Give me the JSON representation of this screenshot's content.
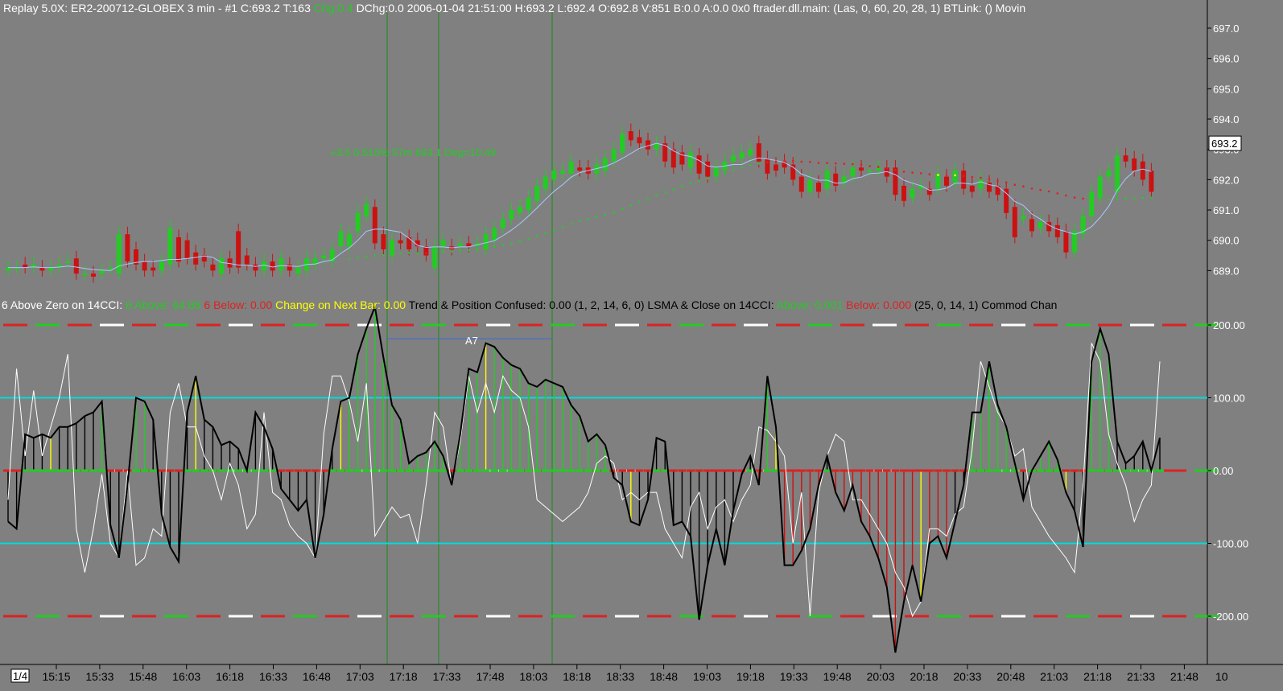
{
  "header": {
    "segments": [
      {
        "text": "Replay 5.0X: ER2-200712-GLOBEX  3 min  - #1   C:693.2  T:163  ",
        "color": "#ffffff"
      },
      {
        "text": "Chg:0.4",
        "color": "#22cc22"
      },
      {
        "text": "  DChg:0.0  2006-01-04  21:51:00  H:693.2  L:692.4  O:692.8  V:851  B:0.0  A:0.0  0x0  ftrader.dll.main:   (Las, 0, 60, 20, 28, 1)  BTLink:  ()  Movin",
        "color": "#ffffff"
      }
    ]
  },
  "subheader": {
    "segments": [
      {
        "text": "6 Above Zero on 14CCI: ",
        "color": "#ffffff"
      },
      {
        "text": "6 Above: 64.88 ",
        "color": "#22cc22"
      },
      {
        "text": "6 Below: 0.00 ",
        "color": "#dd2222"
      },
      {
        "text": "Change on Next Bar: 0.00 ",
        "color": "#ffff00"
      },
      {
        "text": "  Trend & Position Confused: 0.00   (1, 2, 14, 6, 0)   LSMA & Close on 14CCI: ",
        "color": "#000000"
      },
      {
        "text": "Above: 0.001 ",
        "color": "#22cc22"
      },
      {
        "text": "Below: 0.000 ",
        "color": "#dd2222"
      },
      {
        "text": "  (25, 0, 14, 1)   Commod Chan",
        "color": "#000000"
      }
    ]
  },
  "annotation_text": "+3.5  0.510%  57m  693.1  Deg=10.49",
  "marker_label": "A7",
  "x_axis": {
    "page_indicator": "1/4",
    "labels": [
      "15:15",
      "15:33",
      "15:48",
      "16:03",
      "16:18",
      "16:33",
      "16:48",
      "17:03",
      "17:18",
      "17:33",
      "17:48",
      "18:03",
      "18:18",
      "18:33",
      "18:48",
      "19:03",
      "19:18",
      "19:33",
      "19:48",
      "20:03",
      "20:18",
      "20:33",
      "20:48",
      "21:03",
      "21:18",
      "21:33",
      "21:48"
    ],
    "right_label": "10"
  },
  "colors": {
    "background": "#808080",
    "up_candle": "#22cc22",
    "down_candle": "#cc1111",
    "cci_line": "#000000",
    "fast_cci_line": "#ffffff",
    "level_100_line": "#00dddd",
    "vertical_marker": "#1a8a1a",
    "lsma_line": "#a8c8ff"
  },
  "chart_data": [
    {
      "type": "candlestick",
      "title": "ER2-200712-GLOBEX 3 min",
      "y_ticks": [
        "689.0",
        "690.0",
        "691.0",
        "692.0",
        "693.0",
        "694.0",
        "695.0",
        "696.0",
        "697.0"
      ],
      "ylim": [
        688.3,
        698.0
      ],
      "last_price": "693.2",
      "candles": [
        {
          "t": "15:09",
          "o": 689.0,
          "c": 689.1
        },
        {
          "t": "15:12",
          "o": 689.1,
          "c": 689.1
        },
        {
          "t": "15:15",
          "o": 689.2,
          "c": 689.1
        },
        {
          "t": "15:18",
          "o": 689.1,
          "c": 689.2
        },
        {
          "t": "15:21",
          "o": 689.1,
          "c": 689.0
        },
        {
          "t": "15:24",
          "o": 689.0,
          "c": 689.1
        },
        {
          "t": "15:27",
          "o": 689.1,
          "c": 689.2
        },
        {
          "t": "15:30",
          "o": 689.3,
          "c": 689.3
        },
        {
          "t": "15:33",
          "o": 689.4,
          "c": 688.9
        },
        {
          "t": "15:36",
          "o": 688.9,
          "c": 688.9
        },
        {
          "t": "15:39",
          "o": 688.9,
          "c": 688.8
        },
        {
          "t": "15:42",
          "o": 688.9,
          "c": 689.0
        },
        {
          "t": "15:45",
          "o": 689.1,
          "c": 689.1
        },
        {
          "t": "15:48",
          "o": 688.9,
          "c": 690.2
        },
        {
          "t": "15:51",
          "o": 690.2,
          "c": 689.3
        },
        {
          "t": "15:54",
          "o": 689.7,
          "c": 689.2
        },
        {
          "t": "15:57",
          "o": 689.3,
          "c": 689.0
        },
        {
          "t": "16:00",
          "o": 689.1,
          "c": 689.0
        },
        {
          "t": "16:03",
          "o": 689.0,
          "c": 689.3
        },
        {
          "t": "16:06",
          "o": 689.2,
          "c": 690.4
        },
        {
          "t": "16:09",
          "o": 690.1,
          "c": 689.3
        },
        {
          "t": "16:12",
          "o": 690.0,
          "c": 689.4
        },
        {
          "t": "16:15",
          "o": 689.6,
          "c": 689.2
        },
        {
          "t": "16:18",
          "o": 689.5,
          "c": 689.3
        },
        {
          "t": "16:21",
          "o": 689.2,
          "c": 689.0
        },
        {
          "t": "16:24",
          "o": 688.9,
          "c": 689.4
        },
        {
          "t": "16:27",
          "o": 689.4,
          "c": 689.1
        },
        {
          "t": "16:30",
          "o": 690.3,
          "c": 689.1
        },
        {
          "t": "16:33",
          "o": 689.5,
          "c": 689.2
        },
        {
          "t": "16:36",
          "o": 689.2,
          "c": 689.0
        },
        {
          "t": "16:39",
          "o": 689.0,
          "c": 689.3
        },
        {
          "t": "16:42",
          "o": 689.3,
          "c": 689.0
        },
        {
          "t": "16:45",
          "o": 689.0,
          "c": 689.4
        },
        {
          "t": "16:48",
          "o": 689.2,
          "c": 689.0
        },
        {
          "t": "16:51",
          "o": 688.9,
          "c": 689.1
        },
        {
          "t": "16:54",
          "o": 689.0,
          "c": 689.4
        },
        {
          "t": "16:57",
          "o": 689.2,
          "c": 689.4
        },
        {
          "t": "17:00",
          "o": 689.4,
          "c": 689.5
        },
        {
          "t": "17:03",
          "o": 689.3,
          "c": 689.7
        },
        {
          "t": "17:06",
          "o": 689.8,
          "c": 690.3
        },
        {
          "t": "17:09",
          "o": 689.8,
          "c": 690.2
        },
        {
          "t": "17:12",
          "o": 690.3,
          "c": 690.9
        },
        {
          "t": "17:15",
          "o": 690.8,
          "c": 691.2
        },
        {
          "t": "17:18",
          "o": 691.1,
          "c": 689.9
        },
        {
          "t": "17:21",
          "o": 690.2,
          "c": 689.7
        },
        {
          "t": "17:24",
          "o": 689.5,
          "c": 690.0
        },
        {
          "t": "17:27",
          "o": 690.0,
          "c": 689.9
        },
        {
          "t": "17:30",
          "o": 690.1,
          "c": 689.7
        },
        {
          "t": "17:33",
          "o": 690.0,
          "c": 689.8
        },
        {
          "t": "17:36",
          "o": 689.8,
          "c": 689.5
        },
        {
          "t": "17:39",
          "o": 689.1,
          "c": 689.8
        },
        {
          "t": "17:42",
          "o": 689.8,
          "c": 690.0
        },
        {
          "t": "17:45",
          "o": 689.8,
          "c": 689.7
        },
        {
          "t": "17:48",
          "o": 689.8,
          "c": 689.9
        },
        {
          "t": "17:51",
          "o": 689.9,
          "c": 689.8
        },
        {
          "t": "17:54",
          "o": 689.8,
          "c": 689.9
        },
        {
          "t": "17:57",
          "o": 689.7,
          "c": 690.2
        },
        {
          "t": "18:00",
          "o": 690.0,
          "c": 690.4
        },
        {
          "t": "18:03",
          "o": 690.4,
          "c": 690.7
        },
        {
          "t": "18:06",
          "o": 690.7,
          "c": 691.0
        },
        {
          "t": "18:09",
          "o": 690.9,
          "c": 691.1
        },
        {
          "t": "18:12",
          "o": 691.0,
          "c": 691.4
        },
        {
          "t": "18:15",
          "o": 691.3,
          "c": 691.8
        },
        {
          "t": "18:18",
          "o": 691.7,
          "c": 692.1
        },
        {
          "t": "18:21",
          "o": 692.0,
          "c": 692.3
        },
        {
          "t": "18:24",
          "o": 692.2,
          "c": 692.3
        },
        {
          "t": "18:27",
          "o": 692.2,
          "c": 692.6
        },
        {
          "t": "18:30",
          "o": 692.4,
          "c": 692.3
        },
        {
          "t": "18:33",
          "o": 692.4,
          "c": 692.2
        },
        {
          "t": "18:36",
          "o": 692.2,
          "c": 692.5
        },
        {
          "t": "18:39",
          "o": 692.3,
          "c": 692.7
        },
        {
          "t": "18:42",
          "o": 692.6,
          "c": 693.0
        },
        {
          "t": "18:45",
          "o": 692.9,
          "c": 693.5
        },
        {
          "t": "18:48",
          "o": 693.6,
          "c": 693.3
        },
        {
          "t": "18:51",
          "o": 693.4,
          "c": 693.2
        },
        {
          "t": "18:54",
          "o": 693.3,
          "c": 693.0
        },
        {
          "t": "18:57",
          "o": 693.0,
          "c": 693.2
        },
        {
          "t": "19:00",
          "o": 693.2,
          "c": 692.6
        },
        {
          "t": "19:03",
          "o": 693.0,
          "c": 692.4
        },
        {
          "t": "19:06",
          "o": 692.9,
          "c": 692.5
        },
        {
          "t": "19:09",
          "o": 692.4,
          "c": 692.9
        },
        {
          "t": "19:12",
          "o": 692.8,
          "c": 692.2
        },
        {
          "t": "19:15",
          "o": 692.6,
          "c": 692.1
        },
        {
          "t": "19:18",
          "o": 692.1,
          "c": 692.4
        },
        {
          "t": "19:21",
          "o": 692.3,
          "c": 692.6
        },
        {
          "t": "19:24",
          "o": 692.6,
          "c": 692.8
        },
        {
          "t": "19:27",
          "o": 692.7,
          "c": 692.9
        },
        {
          "t": "19:30",
          "o": 692.8,
          "c": 693.0
        },
        {
          "t": "19:33",
          "o": 693.2,
          "c": 692.6
        },
        {
          "t": "19:36",
          "o": 692.7,
          "c": 692.2
        },
        {
          "t": "19:39",
          "o": 692.5,
          "c": 692.3
        },
        {
          "t": "19:42",
          "o": 692.6,
          "c": 692.4
        },
        {
          "t": "19:45",
          "o": 692.5,
          "c": 692.0
        },
        {
          "t": "19:48",
          "o": 692.1,
          "c": 691.6
        },
        {
          "t": "19:51",
          "o": 691.6,
          "c": 692.0
        },
        {
          "t": "19:54",
          "o": 691.9,
          "c": 691.6
        },
        {
          "t": "19:57",
          "o": 691.7,
          "c": 692.3
        },
        {
          "t": "20:00",
          "o": 692.2,
          "c": 691.8
        },
        {
          "t": "20:03",
          "o": 691.9,
          "c": 692.1
        },
        {
          "t": "20:06",
          "o": 692.1,
          "c": 692.4
        },
        {
          "t": "20:09",
          "o": 692.4,
          "c": 692.3
        },
        {
          "t": "20:12",
          "o": 692.3,
          "c": 692.3
        },
        {
          "t": "20:15",
          "o": 692.3,
          "c": 692.4
        },
        {
          "t": "20:18",
          "o": 692.4,
          "c": 692.1
        },
        {
          "t": "20:21",
          "o": 692.4,
          "c": 691.5
        },
        {
          "t": "20:24",
          "o": 691.8,
          "c": 691.3
        },
        {
          "t": "20:27",
          "o": 691.4,
          "c": 691.7
        },
        {
          "t": "20:30",
          "o": 691.7,
          "c": 691.8
        },
        {
          "t": "20:33",
          "o": 691.7,
          "c": 691.5
        },
        {
          "t": "20:36",
          "o": 691.7,
          "c": 692.2
        },
        {
          "t": "20:39",
          "o": 692.1,
          "c": 691.8
        },
        {
          "t": "20:42",
          "o": 691.9,
          "c": 692.3
        },
        {
          "t": "20:45",
          "o": 692.3,
          "c": 691.7
        },
        {
          "t": "20:48",
          "o": 691.8,
          "c": 691.6
        },
        {
          "t": "20:51",
          "o": 691.7,
          "c": 692.0
        },
        {
          "t": "20:54",
          "o": 691.9,
          "c": 691.6
        },
        {
          "t": "20:57",
          "o": 691.8,
          "c": 691.5
        },
        {
          "t": "21:00",
          "o": 691.7,
          "c": 690.9
        },
        {
          "t": "21:03",
          "o": 691.1,
          "c": 690.1
        },
        {
          "t": "21:06",
          "o": 690.7,
          "c": 690.8
        },
        {
          "t": "21:09",
          "o": 690.7,
          "c": 690.3
        },
        {
          "t": "21:12",
          "o": 690.4,
          "c": 690.6
        },
        {
          "t": "21:15",
          "o": 690.6,
          "c": 690.3
        },
        {
          "t": "21:18",
          "o": 690.5,
          "c": 690.1
        },
        {
          "t": "21:21",
          "o": 690.3,
          "c": 689.6
        },
        {
          "t": "21:24",
          "o": 689.6,
          "c": 690.3
        },
        {
          "t": "21:27",
          "o": 690.2,
          "c": 690.8
        },
        {
          "t": "21:30",
          "o": 690.8,
          "c": 691.6
        },
        {
          "t": "21:33",
          "o": 691.4,
          "c": 692.1
        },
        {
          "t": "21:36",
          "o": 692.1,
          "c": 692.3
        },
        {
          "t": "21:39",
          "o": 691.6,
          "c": 692.8
        },
        {
          "t": "21:42",
          "o": 692.8,
          "c": 692.6
        },
        {
          "t": "21:45",
          "o": 692.7,
          "c": 692.3
        },
        {
          "t": "21:48",
          "o": 692.6,
          "c": 692.0
        },
        {
          "t": "21:51",
          "o": 692.3,
          "c": 691.6
        }
      ]
    },
    {
      "type": "line",
      "title": "14CCI",
      "y_ticks": [
        "200.00",
        "100.00",
        "0.00",
        "-100.00",
        "-200.00"
      ],
      "ylim": [
        -260,
        232
      ],
      "series": [
        {
          "name": "14CCI",
          "values": [
            -70,
            -80,
            50,
            45,
            50,
            45,
            60,
            60,
            65,
            75,
            80,
            95,
            -75,
            -120,
            -20,
            100,
            95,
            70,
            -60,
            -105,
            -125,
            80,
            130,
            70,
            60,
            35,
            40,
            30,
            0,
            80,
            60,
            30,
            -25,
            -40,
            -55,
            -40,
            -120,
            -60,
            30,
            95,
            100,
            160,
            195,
            225,
            155,
            90,
            70,
            10,
            20,
            25,
            40,
            20,
            -20,
            50,
            140,
            135,
            175,
            170,
            155,
            145,
            140,
            120,
            115,
            125,
            120,
            115,
            90,
            75,
            40,
            50,
            35,
            -10,
            -20,
            -70,
            -75,
            -40,
            45,
            40,
            -75,
            -70,
            -90,
            -205,
            -130,
            -80,
            -130,
            -55,
            -5,
            20,
            -20,
            130,
            60,
            -130,
            -130,
            -110,
            -80,
            -20,
            20,
            -30,
            -55,
            -20,
            -70,
            -90,
            -120,
            -160,
            -250,
            -180,
            -130,
            -180,
            -100,
            -90,
            -120,
            -70,
            -20,
            80,
            80,
            150,
            90,
            60,
            10,
            -40,
            0,
            20,
            40,
            15,
            -30,
            -55,
            -105,
            150,
            195,
            160,
            40,
            10,
            20,
            40,
            0,
            45
          ]
        },
        {
          "name": "6CCI",
          "values": [
            -40,
            140,
            20,
            110,
            20,
            60,
            100,
            160,
            -80,
            -140,
            -80,
            -5,
            -100,
            -120,
            0,
            -130,
            -120,
            -80,
            -90,
            80,
            120,
            60,
            60,
            20,
            0,
            -40,
            10,
            -20,
            -80,
            -60,
            80,
            -30,
            -40,
            -75,
            -90,
            -100,
            -120,
            50,
            130,
            130,
            95,
            40,
            120,
            -90,
            -70,
            -50,
            -65,
            -60,
            -100,
            -20,
            80,
            60,
            -20,
            40,
            130,
            80,
            120,
            80,
            130,
            110,
            100,
            60,
            -40,
            -50,
            -60,
            -70,
            -60,
            -50,
            -30,
            10,
            20,
            10,
            -40,
            -30,
            -40,
            -30,
            -30,
            -80,
            -100,
            -120,
            -50,
            -30,
            -80,
            -50,
            -40,
            -70,
            -40,
            -20,
            60,
            55,
            40,
            20,
            -100,
            -30,
            -200,
            -30,
            20,
            50,
            40,
            -40,
            -40,
            -60,
            -80,
            -100,
            -140,
            -160,
            -200,
            -180,
            -80,
            -80,
            -90,
            -60,
            -50,
            30,
            150,
            115,
            80,
            60,
            20,
            30,
            -50,
            -70,
            -90,
            -105,
            -120,
            -140,
            -20,
            175,
            150,
            50,
            10,
            -20,
            -70,
            -40,
            -20,
            150
          ]
        }
      ],
      "levels": [
        200,
        100,
        0,
        -100,
        -200
      ]
    }
  ]
}
